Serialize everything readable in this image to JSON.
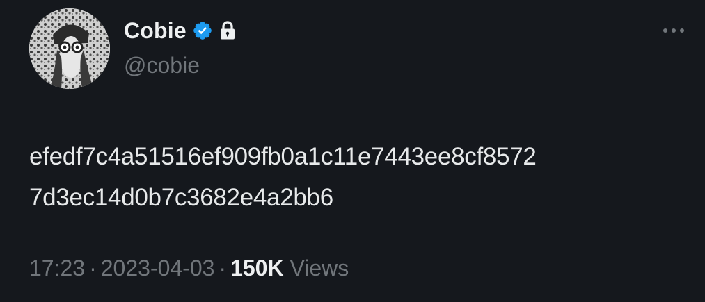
{
  "author": {
    "display_name": "Cobie",
    "handle": "@cobie",
    "verified": true,
    "protected": true
  },
  "tweet": {
    "text_line_1": "efedf7c4a51516ef909fb0a1c11e7443ee8cf8572",
    "text_line_2": "7d3ec14d0b7c3682e4a2bb6",
    "time": "17:23",
    "date": "2023-04-03",
    "separator": "·",
    "views_count": "150K",
    "views_label": "Views"
  },
  "colors": {
    "background": "#15181d",
    "primary_text": "#e7e9ea",
    "secondary_text": "#71767b",
    "verified_badge": "#1d9bf0"
  },
  "icons": {
    "verified": "verified-badge-icon",
    "lock": "lock-icon",
    "more": "more-options-icon"
  }
}
